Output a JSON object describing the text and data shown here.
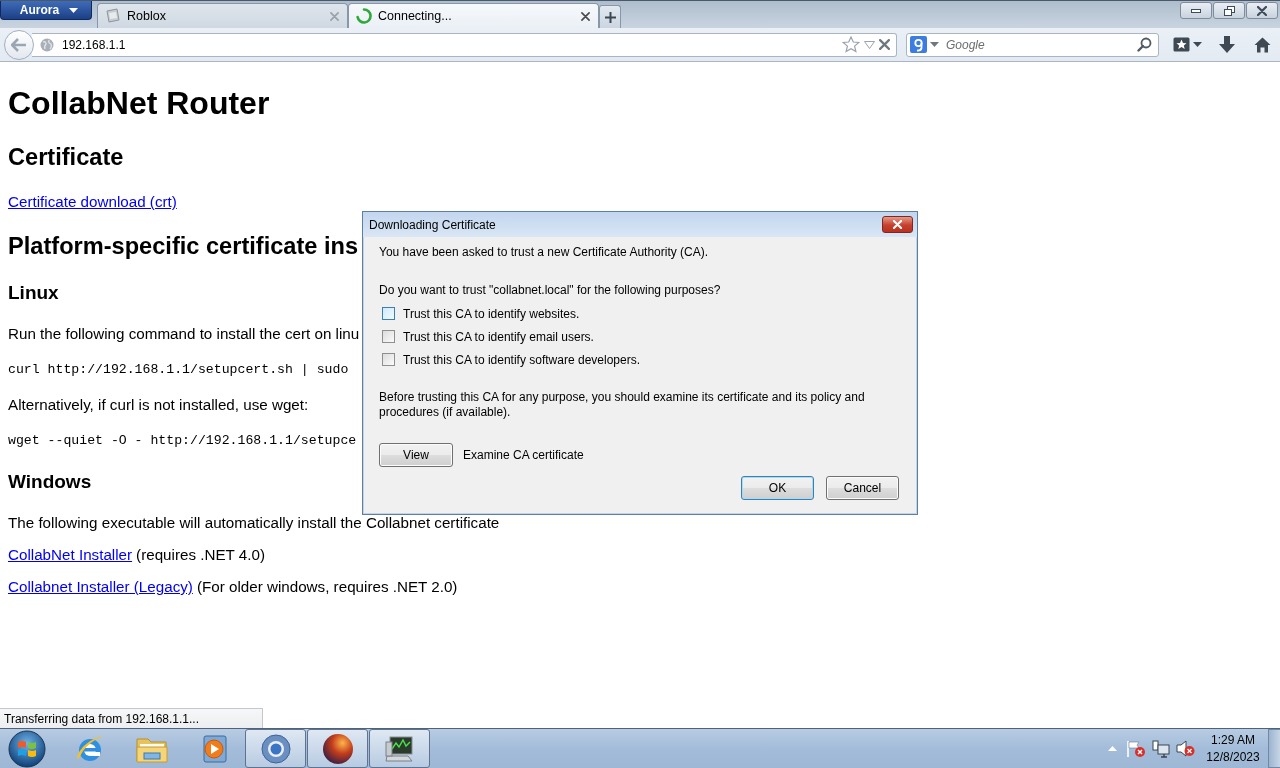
{
  "browser": {
    "app_button": "Aurora",
    "tabs": [
      {
        "title": "Roblox",
        "selected": false,
        "loading": false
      },
      {
        "title": "Connecting...",
        "selected": true,
        "loading": true
      }
    ],
    "address": "192.168.1.1",
    "search": {
      "placeholder": "Google"
    }
  },
  "page": {
    "title": "CollabNet Router",
    "blocks": [
      {
        "kind": "h2",
        "text": "Certificate"
      },
      {
        "kind": "link",
        "text": "Certificate download (crt)"
      },
      {
        "kind": "h2",
        "text": "Platform-specific certificate ins"
      },
      {
        "kind": "h3",
        "text": "Linux"
      },
      {
        "kind": "p",
        "text": "Run the following command to install the cert on linu"
      },
      {
        "kind": "code",
        "text": "curl http://192.168.1.1/setupcert.sh | sudo"
      },
      {
        "kind": "p",
        "text": "Alternatively, if curl is not installed, use wget:"
      },
      {
        "kind": "code",
        "text": "wget --quiet -O - http://192.168.1.1/setupce"
      },
      {
        "kind": "h3",
        "text": "Windows"
      },
      {
        "kind": "p",
        "text": "The following executable will automatically install the Collabnet certificate"
      },
      {
        "kind": "link",
        "text": "CollabNet Installer",
        "note": "(requires .NET 4.0)"
      },
      {
        "kind": "link",
        "text": "Collabnet Installer (Legacy)",
        "note": "(For older windows, requires .NET 2.0)"
      }
    ]
  },
  "dialog": {
    "title": "Downloading Certificate",
    "intro": "You have been asked to trust a new Certificate Authority (CA).",
    "question": "Do you want to trust \"collabnet.local\" for the following purposes?",
    "options": [
      {
        "label": "Trust this CA to identify websites.",
        "checked": false,
        "hovered": true
      },
      {
        "label": "Trust this CA to identify email users.",
        "checked": false,
        "hovered": false
      },
      {
        "label": "Trust this CA to identify software developers.",
        "checked": false,
        "hovered": false
      }
    ],
    "note": "Before trusting this CA for any purpose, you should examine its certificate and its policy and procedures (if available).",
    "view_button": "View",
    "view_label": "Examine CA certificate",
    "buttons": [
      {
        "label": "OK",
        "default": true
      },
      {
        "label": "Cancel",
        "default": false
      }
    ]
  },
  "status_bar": "Transferring data from 192.168.1.1...",
  "taskbar": {
    "apps": [
      {
        "kind": "ie",
        "running": false
      },
      {
        "kind": "explorer",
        "running": false
      },
      {
        "kind": "media",
        "running": false
      },
      {
        "kind": "chrome",
        "running": true
      },
      {
        "kind": "firefox",
        "running": true
      },
      {
        "kind": "monitor",
        "running": true
      }
    ],
    "clock": {
      "time": "1:29 AM",
      "date": "12/8/2023"
    }
  }
}
